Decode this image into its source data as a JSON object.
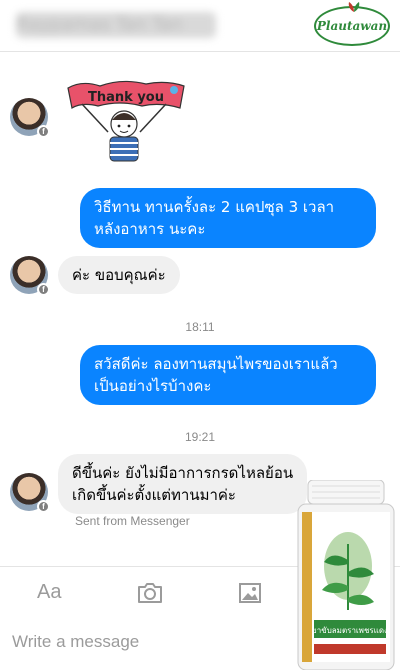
{
  "header": {
    "contact_name": "Raypamas Tan Tan",
    "brand_logo_text": "Plautawan"
  },
  "thread": {
    "sticker_text": "Thank you",
    "messages": [
      {
        "direction": "out",
        "lines": [
          "วิธีทาน ทานครั้งละ 2 แคปซุล 3 เวลา",
          "หลังอาหาร นะคะ"
        ]
      },
      {
        "direction": "in",
        "lines": [
          "ค่ะ ขอบคุณค่ะ"
        ]
      },
      {
        "direction": "out",
        "lines": [
          "สวัสดีค่ะ ลองทานสมุนไพรของเราแล้ว",
          "เป็นอย่างไรบ้างคะ"
        ]
      },
      {
        "direction": "in",
        "lines": [
          "ดีขึ้นค่ะ ยังไม่มีอาการกรดไหลย้อน",
          "เกิดขึ้นค่ะตั้งแต่ทานมาค่ะ"
        ]
      }
    ],
    "timestamps": [
      "18:11",
      "19:21"
    ],
    "sent_from": "Sent from Messenger"
  },
  "composer": {
    "aa_label": "Aa",
    "placeholder": "Write a message"
  },
  "product": {
    "label_text": "ยาขับลมตราเพชรแดง"
  },
  "colors": {
    "outgoing_bubble": "#0a84ff",
    "incoming_bubble": "#f0f0f0",
    "brand_green": "#2f8a3b"
  },
  "icons": [
    "facebook-badge-icon",
    "camera-icon",
    "image-gallery-icon"
  ]
}
